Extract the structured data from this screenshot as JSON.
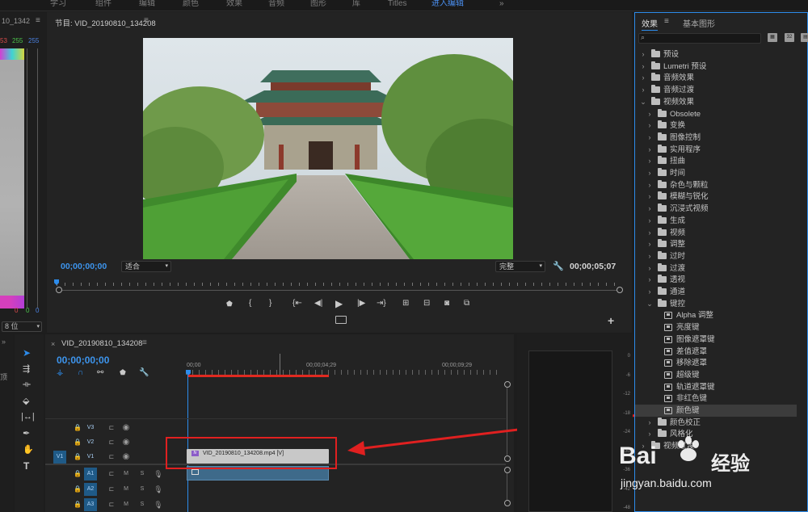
{
  "top_tabs": [
    "学习",
    "组件",
    "编辑",
    "颜色",
    "效果",
    "音频",
    "图形",
    "库",
    "Titles",
    "进入编辑"
  ],
  "left_panel": {
    "title": "10_1342",
    "rgb_values": [
      "53",
      "255",
      "255"
    ],
    "bottom_values": [
      "0",
      "0",
      "0"
    ],
    "bit_select": "8 位"
  },
  "program_monitor": {
    "title": "节目: VID_20190810_134208",
    "menu_icon": "≡",
    "timecode": "00;00;00;00",
    "fit_select": "适合",
    "quality_select": "完整",
    "duration": "00;00;05;07",
    "wrench_icon": "wrench-icon"
  },
  "transport": {
    "buttons": [
      "marker-icon",
      "in-point-icon",
      "out-point-icon",
      "go-to-in-icon",
      "step-back-icon",
      "play-icon",
      "step-forward-icon",
      "go-to-out-icon",
      "lift-icon",
      "extract-icon",
      "export-frame-icon",
      "compare-icon"
    ],
    "add_button": "+"
  },
  "timeline": {
    "tab_close": "×",
    "title": "VID_20190810_134208",
    "menu_icon": "≡",
    "timecode": "00;00;00;00",
    "ruler": [
      "00;00",
      "00;00;04;29",
      "00;00;09;29"
    ],
    "tracks": [
      {
        "source": "",
        "name": "V3",
        "type": "video"
      },
      {
        "source": "",
        "name": "V2",
        "type": "video"
      },
      {
        "source": "V1",
        "name": "V1",
        "type": "video"
      },
      {
        "source": "",
        "name": "A1",
        "type": "audio"
      },
      {
        "source": "",
        "name": "A2",
        "type": "audio"
      },
      {
        "source": "",
        "name": "A3",
        "type": "audio"
      }
    ],
    "track_buttons": {
      "mute": "M",
      "solo": "S"
    },
    "clip_label": "VID_20190810_134208.mp4 [V]",
    "clip_fx": "fx"
  },
  "tools": [
    "selection-tool-icon",
    "track-select-tool-icon",
    "ripple-edit-tool-icon",
    "razor-tool-icon",
    "slip-tool-icon",
    "pen-tool-icon",
    "hand-tool-icon",
    "type-tool-icon"
  ],
  "left_side_text": "顶",
  "audio_meter": {
    "ticks": [
      "0",
      "-6",
      "-12",
      "-18",
      "-24",
      "-30",
      "-36",
      "-42",
      "-48"
    ]
  },
  "effects_panel": {
    "tab_effects": "效果",
    "tab_menu": "≡",
    "tab_graphics": "基本图形",
    "search_icon": "search-icon",
    "badges": [
      "accelerated-icon",
      "32-bit-icon",
      "yuv-icon"
    ],
    "items": [
      {
        "label": "预设",
        "level": 0,
        "expanded": false,
        "kind": "folder"
      },
      {
        "label": "Lumetri 预设",
        "level": 0,
        "expanded": false,
        "kind": "folder"
      },
      {
        "label": "音频效果",
        "level": 0,
        "expanded": false,
        "kind": "folder"
      },
      {
        "label": "音频过渡",
        "level": 0,
        "expanded": false,
        "kind": "folder"
      },
      {
        "label": "视频效果",
        "level": 0,
        "expanded": true,
        "kind": "folder"
      },
      {
        "label": "Obsolete",
        "level": 1,
        "expanded": false,
        "kind": "folder"
      },
      {
        "label": "变换",
        "level": 1,
        "expanded": false,
        "kind": "folder"
      },
      {
        "label": "图像控制",
        "level": 1,
        "expanded": false,
        "kind": "folder"
      },
      {
        "label": "实用程序",
        "level": 1,
        "expanded": false,
        "kind": "folder"
      },
      {
        "label": "扭曲",
        "level": 1,
        "expanded": false,
        "kind": "folder"
      },
      {
        "label": "时间",
        "level": 1,
        "expanded": false,
        "kind": "folder"
      },
      {
        "label": "杂色与颗粒",
        "level": 1,
        "expanded": false,
        "kind": "folder"
      },
      {
        "label": "模糊与锐化",
        "level": 1,
        "expanded": false,
        "kind": "folder"
      },
      {
        "label": "沉浸式视频",
        "level": 1,
        "expanded": false,
        "kind": "folder"
      },
      {
        "label": "生成",
        "level": 1,
        "expanded": false,
        "kind": "folder"
      },
      {
        "label": "视频",
        "level": 1,
        "expanded": false,
        "kind": "folder"
      },
      {
        "label": "调整",
        "level": 1,
        "expanded": false,
        "kind": "folder"
      },
      {
        "label": "过时",
        "level": 1,
        "expanded": false,
        "kind": "folder"
      },
      {
        "label": "过渡",
        "level": 1,
        "expanded": false,
        "kind": "folder"
      },
      {
        "label": "透视",
        "level": 1,
        "expanded": false,
        "kind": "folder"
      },
      {
        "label": "通道",
        "level": 1,
        "expanded": false,
        "kind": "folder"
      },
      {
        "label": "键控",
        "level": 1,
        "expanded": true,
        "kind": "folder"
      },
      {
        "label": "Alpha 调整",
        "level": 2,
        "kind": "effect"
      },
      {
        "label": "亮度键",
        "level": 2,
        "kind": "effect"
      },
      {
        "label": "图像遮罩键",
        "level": 2,
        "kind": "effect"
      },
      {
        "label": "差值遮罩",
        "level": 2,
        "kind": "effect"
      },
      {
        "label": "移除遮罩",
        "level": 2,
        "kind": "effect"
      },
      {
        "label": "超级键",
        "level": 2,
        "kind": "effect"
      },
      {
        "label": "轨道遮罩键",
        "level": 2,
        "kind": "effect"
      },
      {
        "label": "非红色键",
        "level": 2,
        "kind": "effect"
      },
      {
        "label": "颜色键",
        "level": 2,
        "kind": "effect",
        "selected": true
      },
      {
        "label": "颜色校正",
        "level": 1,
        "expanded": false,
        "kind": "folder"
      },
      {
        "label": "风格化",
        "level": 1,
        "expanded": false,
        "kind": "folder"
      },
      {
        "label": "视频过渡",
        "level": 0,
        "expanded": false,
        "kind": "folder"
      }
    ]
  },
  "watermark": {
    "brand": "Bai",
    "brand_cn": "经验",
    "url": "jingyan.baidu.com"
  },
  "colors": {
    "accent_blue": "#2d8ceb",
    "highlight_red": "#e02020",
    "clip_gray": "#c8c8c8",
    "audio_clip": "#3e6a8a"
  }
}
